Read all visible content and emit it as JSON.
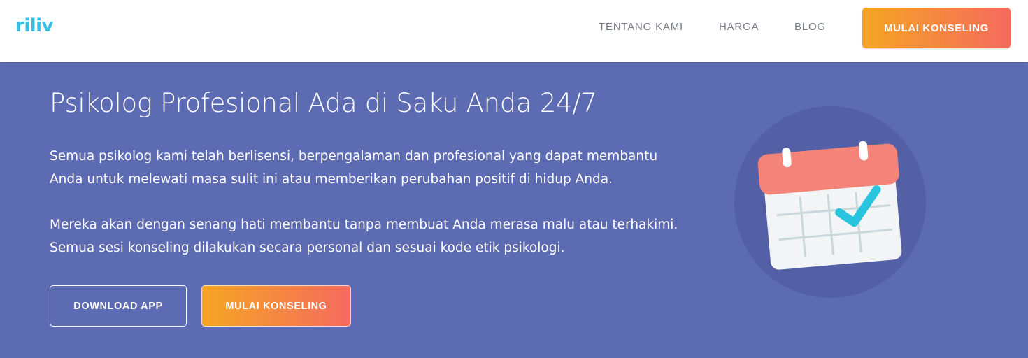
{
  "nav": {
    "logo": "riliv",
    "links": [
      "TENTANG KAMI",
      "HARGA",
      "BLOG"
    ],
    "cta": "MULAI KONSELING"
  },
  "hero": {
    "title": "Psikolog Profesional Ada di Saku Anda 24/7",
    "paragraph1": "Semua psikolog kami telah berlisensi, berpengalaman dan profesional yang dapat membantu Anda untuk melewati masa sulit ini atau memberikan perubahan positif di hidup Anda.",
    "paragraph2": "Mereka akan dengan senang hati membantu tanpa membuat Anda merasa malu atau terhakimi. Semua sesi konseling dilakukan secara personal dan sesuai kode etik psikologi.",
    "download_label": "DOWNLOAD APP",
    "cta_label": "MULAI KONSELING"
  },
  "illustration": {
    "icon": "calendar-check-icon"
  },
  "colors": {
    "background": "#5d6bb3",
    "circle": "#5360a5",
    "accent_start": "#f5a623",
    "accent_end": "#f56a5e",
    "logo": "#35bfe0",
    "check": "#29c4e0",
    "calendar_header": "#f4847a"
  }
}
